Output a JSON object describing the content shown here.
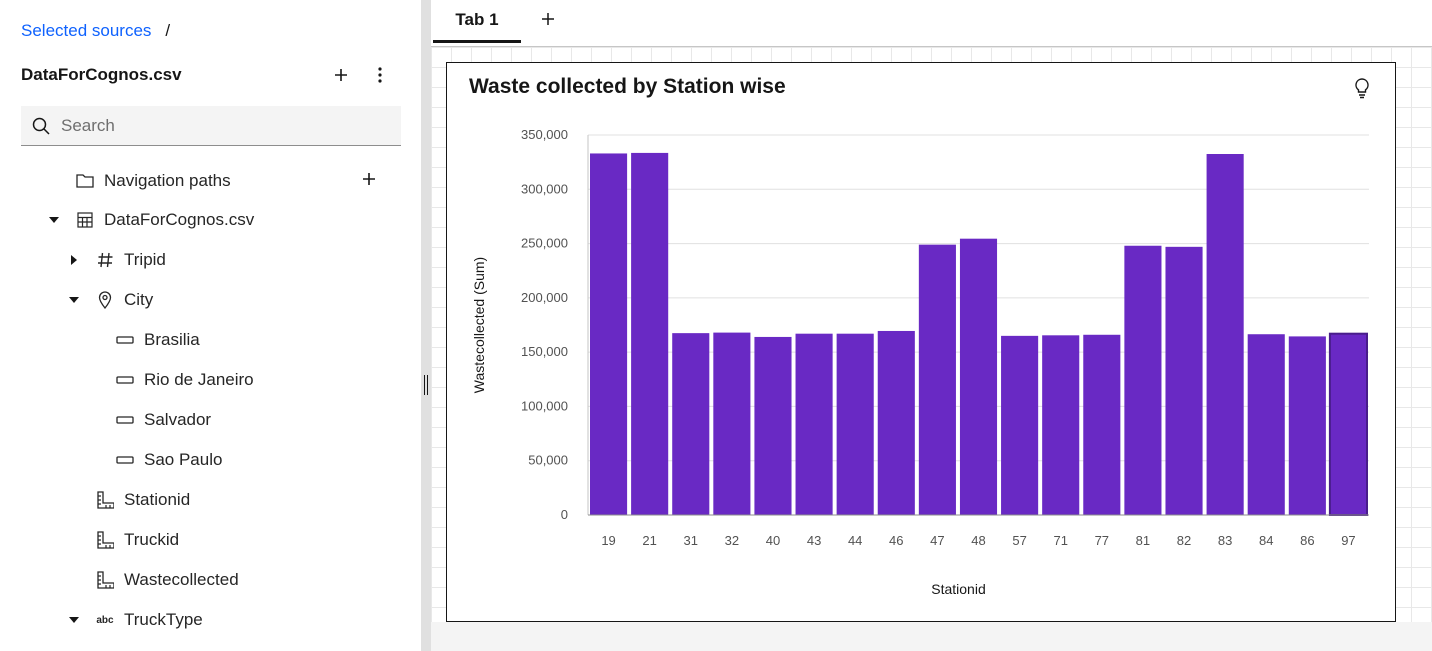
{
  "breadcrumb": {
    "link": "Selected sources",
    "separator": "/"
  },
  "source": {
    "title": "DataForCognos.csv"
  },
  "search": {
    "placeholder": "Search"
  },
  "tree": {
    "navigation_paths": "Navigation paths",
    "table": "DataForCognos.csv",
    "tripid": "Tripid",
    "city": "City",
    "cities": [
      "Brasilia",
      "Rio de Janeiro",
      "Salvador",
      "Sao Paulo"
    ],
    "stationid": "Stationid",
    "truckid": "Truckid",
    "wastecollected": "Wastecollected",
    "trucktype": "TruckType",
    "trucktype_icon_text": "abc"
  },
  "tabs": {
    "tab1": "Tab 1"
  },
  "widget": {
    "title": "Waste collected by Station wise"
  },
  "colors": {
    "bar": "#6929c4",
    "link": "#0f62fe"
  },
  "chart_data": {
    "type": "bar",
    "title": "Waste collected by Station wise",
    "xlabel": "Stationid",
    "ylabel": "Wastecollected (Sum)",
    "categories": [
      "19",
      "21",
      "31",
      "32",
      "40",
      "43",
      "44",
      "46",
      "47",
      "48",
      "57",
      "71",
      "77",
      "81",
      "82",
      "83",
      "84",
      "86",
      "97"
    ],
    "values": [
      333000,
      333500,
      167500,
      168000,
      164000,
      167000,
      167000,
      169500,
      249000,
      254500,
      165000,
      165500,
      166000,
      248000,
      247000,
      332500,
      166500,
      164500,
      167000
    ],
    "yticks": [
      "0",
      "50,000",
      "100,000",
      "150,000",
      "200,000",
      "250,000",
      "300,000",
      "350,000"
    ],
    "ylim": [
      0,
      350000
    ],
    "grid": true
  }
}
